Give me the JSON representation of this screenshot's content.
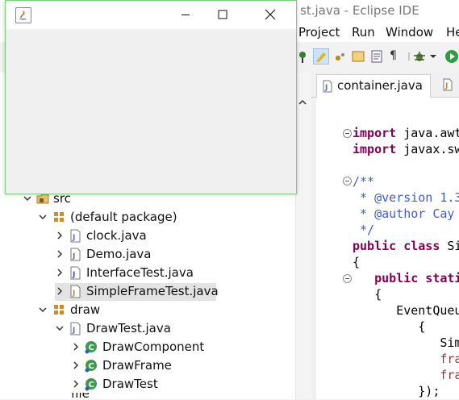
{
  "eclipse": {
    "title_fragment": "st.java - Eclipse IDE",
    "menu": [
      "Project",
      "Run",
      "Window",
      "He"
    ]
  },
  "editor": {
    "tab_label": "container.java",
    "lines": [
      {
        "t": "import",
        "r": " java.awt"
      },
      {
        "t": "import",
        "r": " javax.sw"
      },
      {
        "t": "",
        "r": ""
      },
      {
        "t": "",
        "r": "/**"
      },
      {
        "t": "",
        "r": " * @version 1.3"
      },
      {
        "t": "",
        "r": " * @author Cay"
      },
      {
        "t": "",
        "r": " */"
      },
      {
        "t": "public class",
        "r": " Si"
      },
      {
        "t": "",
        "r": "{"
      },
      {
        "t": "   public stati",
        "r": ""
      },
      {
        "t": "",
        "r": "   {"
      },
      {
        "t": "",
        "r": "      EventQueu"
      },
      {
        "t": "",
        "r": "         {"
      },
      {
        "t": "",
        "r": "            Sim"
      },
      {
        "t": "",
        "r": "            fra"
      },
      {
        "t": "",
        "r": "            fra"
      },
      {
        "t": "",
        "r": "         });"
      }
    ]
  },
  "tree": {
    "src": "src",
    "default_package": "(default package)",
    "files": [
      "clock.java",
      "Demo.java",
      "InterfaceTest.java",
      "SimpleFrameTest.java"
    ],
    "draw_package": "draw",
    "draw_file": "DrawTest.java",
    "draw_classes": [
      "DrawComponent",
      "DrawFrame",
      "DrawTest"
    ],
    "partial": "file"
  }
}
